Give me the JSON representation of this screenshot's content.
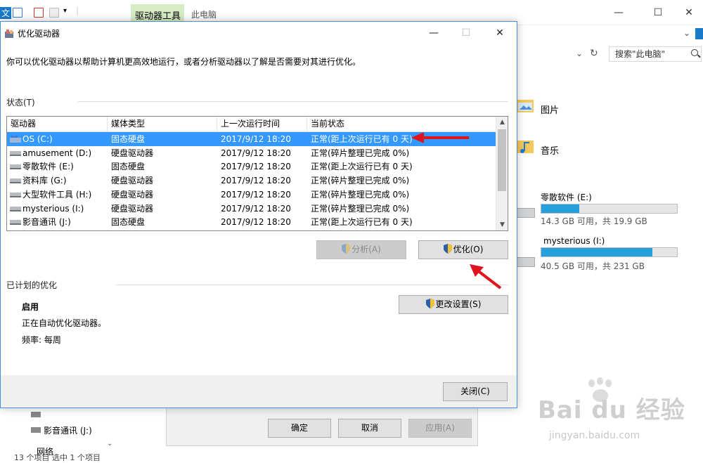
{
  "explorer": {
    "ribbon_tab_cut": "文",
    "ribbon_context_tab": "驱动器工具",
    "breadcrumb_title": "此电脑",
    "search_placeholder": "搜索\"此电脑\"",
    "folders": [
      {
        "name": "图片"
      },
      {
        "name": "音乐"
      }
    ],
    "drives": [
      {
        "name": "零散软件 (E:)",
        "usage_text": "14.3 GB 可用，共 19.9 GB",
        "used_fraction": 0.28
      },
      {
        "name": "mysterious (I:)",
        "usage_text": "40.5 GB 可用，共 231 GB",
        "used_fraction": 0.82
      }
    ],
    "sidebar_bottom": {
      "drive_label": "影音通讯 (J:)",
      "network_label_partial": "网络"
    },
    "status_partial": "13 个项目    选中 1 个项目"
  },
  "props_dialog": {
    "ok_label": "确定",
    "cancel_label": "取消",
    "apply_label": "应用(A)"
  },
  "optimize_dialog": {
    "title": "优化驱动器",
    "description": "你可以优化驱动器以帮助计算机更高效地运行，或者分析驱动器以了解是否需要对其进行优化。",
    "status_group_label": "状态(T)",
    "columns": [
      "驱动器",
      "媒体类型",
      "上一次运行时间",
      "当前状态"
    ],
    "rows": [
      {
        "drive": "OS (C:)",
        "media": "固态硬盘",
        "last_run": "2017/9/12 18:20",
        "status": "正常(距上次运行已有 0 天)",
        "selected": true
      },
      {
        "drive": "amusement (D:)",
        "media": "硬盘驱动器",
        "last_run": "2017/9/12 18:20",
        "status": "正常(碎片整理已完成 0%)"
      },
      {
        "drive": "零散软件 (E:)",
        "media": "固态硬盘",
        "last_run": "2017/9/12 18:20",
        "status": "正常(距上次运行已有 0 天)"
      },
      {
        "drive": "资料库 (G:)",
        "media": "硬盘驱动器",
        "last_run": "2017/9/12 18:20",
        "status": "正常(碎片整理已完成 0%)"
      },
      {
        "drive": "大型软件工具 (H:)",
        "media": "硬盘驱动器",
        "last_run": "2017/9/12 18:20",
        "status": "正常(碎片整理已完成 0%)"
      },
      {
        "drive": "mysterious (I:)",
        "media": "硬盘驱动器",
        "last_run": "2017/9/12 18:20",
        "status": "正常(碎片整理已完成 0%)"
      },
      {
        "drive": "影音通讯 (J:)",
        "media": "固态硬盘",
        "last_run": "2017/9/12 18:20",
        "status": "正常(距上次运行已有 0 天)"
      }
    ],
    "analyze_label": "分析(A)",
    "optimize_label": "优化(O)",
    "scheduled_group_label": "已计划的优化",
    "schedule_state": "启用",
    "schedule_desc": "正在自动优化驱动器。",
    "schedule_freq": "频率: 每周",
    "change_settings_label": "更改设置(S)",
    "close_label": "关闭(C)"
  },
  "watermark": {
    "logo_text": "Bai du 经验",
    "url": "jingyan.baidu.com"
  },
  "colors": {
    "selection": "#3399ff",
    "drive_fill": "#26a0da",
    "annotation_arrow": "#e0141e",
    "context_tab": "#d7ecc4"
  }
}
